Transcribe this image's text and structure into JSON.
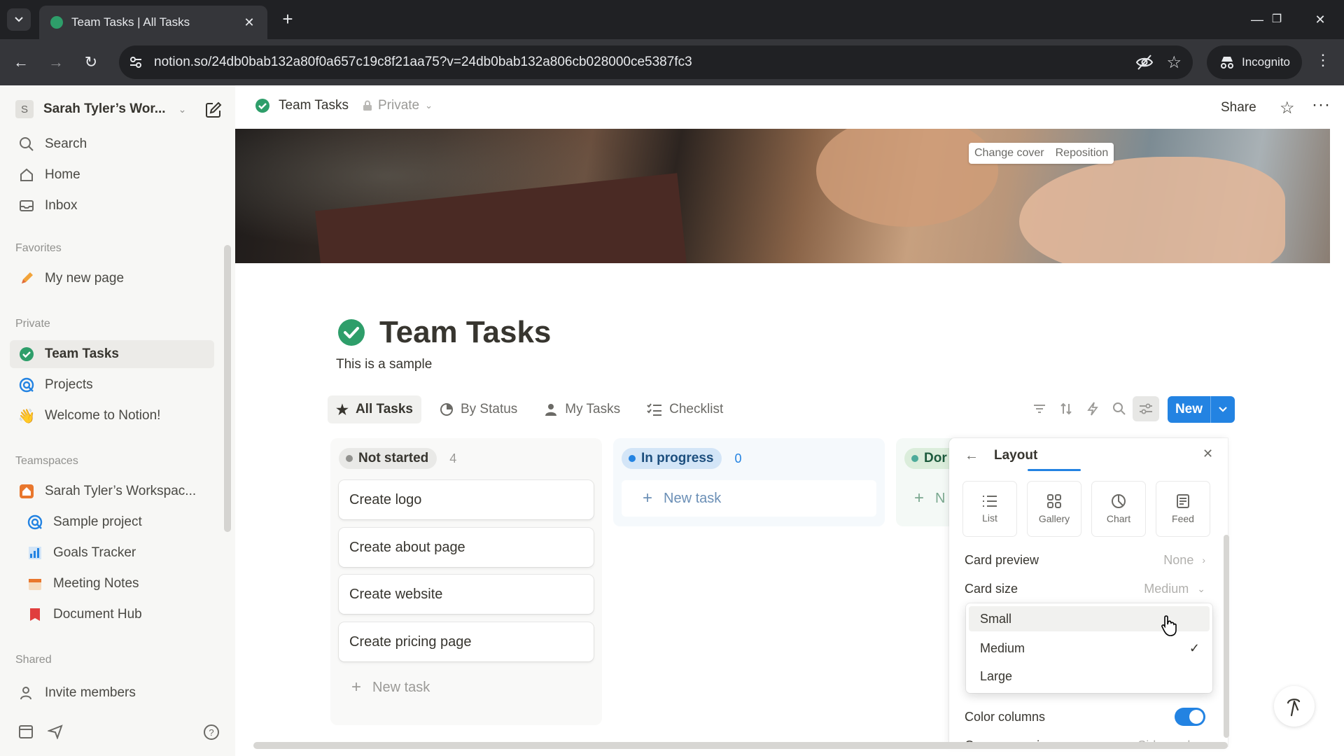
{
  "browser": {
    "tab_title": "Team Tasks | All Tasks",
    "url": "notion.so/24db0bab132a80f0a657c19c8f21aa75?v=24db0bab132a806cb028000ce5387fc3",
    "incognito_label": "Incognito"
  },
  "sidebar": {
    "workspace_name": "Sarah Tyler’s Wor...",
    "workspace_initial": "S",
    "top_items": [
      {
        "label": "Search",
        "icon": "search-icon"
      },
      {
        "label": "Home",
        "icon": "home-icon"
      },
      {
        "label": "Inbox",
        "icon": "inbox-icon"
      }
    ],
    "favorites_label": "Favorites",
    "favorites": [
      {
        "label": "My new page",
        "icon": "pencil-icon"
      }
    ],
    "private_label": "Private",
    "private": [
      {
        "label": "Team Tasks",
        "icon": "check-circle-icon"
      },
      {
        "label": "Projects",
        "icon": "target-icon"
      },
      {
        "label": "Welcome to Notion!",
        "icon": "wave-icon"
      }
    ],
    "teamspaces_label": "Teamspaces",
    "teamspaces": [
      {
        "label": "Sarah Tyler’s Workspac...",
        "icon": "house-icon"
      },
      {
        "label": "Sample project",
        "icon": "target-icon"
      },
      {
        "label": "Goals Tracker",
        "icon": "chart-icon"
      },
      {
        "label": "Meeting Notes",
        "icon": "calendar-icon"
      },
      {
        "label": "Document Hub",
        "icon": "book-icon"
      }
    ],
    "shared_label": "Shared",
    "invite_label": "Invite members"
  },
  "topbar": {
    "breadcrumb": "Team Tasks",
    "privacy": "Private",
    "share_label": "Share"
  },
  "cover": {
    "change_cover": "Change cover",
    "reposition": "Reposition"
  },
  "page": {
    "title": "Team Tasks",
    "description": "This is a sample",
    "views": [
      {
        "label": "All Tasks",
        "icon": "star-icon"
      },
      {
        "label": "By Status",
        "icon": "status-icon"
      },
      {
        "label": "My Tasks",
        "icon": "person-icon"
      },
      {
        "label": "Checklist",
        "icon": "checklist-icon"
      }
    ],
    "new_button": "New"
  },
  "board": {
    "columns": [
      {
        "status": "Not started",
        "count": "4",
        "color": "#91918e",
        "cards": [
          "Create logo",
          "Create about page",
          "Create website",
          "Create pricing page"
        ],
        "new_task": "New task"
      },
      {
        "status": "In progress",
        "count": "0",
        "color": "#2383e2",
        "cards": [],
        "new_task": "New task"
      },
      {
        "status": "Dor",
        "count": "",
        "color": "#4dab9a",
        "cards": [],
        "new_task": "N"
      }
    ]
  },
  "layout_panel": {
    "title": "Layout",
    "options": [
      {
        "label": "List",
        "icon": "list-icon"
      },
      {
        "label": "Gallery",
        "icon": "gallery-icon"
      },
      {
        "label": "Chart",
        "icon": "chart-icon"
      },
      {
        "label": "Feed",
        "icon": "feed-icon"
      }
    ],
    "card_preview_label": "Card preview",
    "card_preview_value": "None",
    "card_size_label": "Card size",
    "card_size_value": "Medium",
    "card_size_options": [
      "Small",
      "Medium",
      "Large"
    ],
    "card_size_selected": "Medium",
    "color_columns_label": "Color columns",
    "color_columns_on": true,
    "open_pages_label": "Open pages in",
    "open_pages_value": "Side peek"
  },
  "colors": {
    "accent": "#2383e2",
    "done_green": "#4dab9a",
    "sidebar_bg": "#f7f7f5"
  }
}
